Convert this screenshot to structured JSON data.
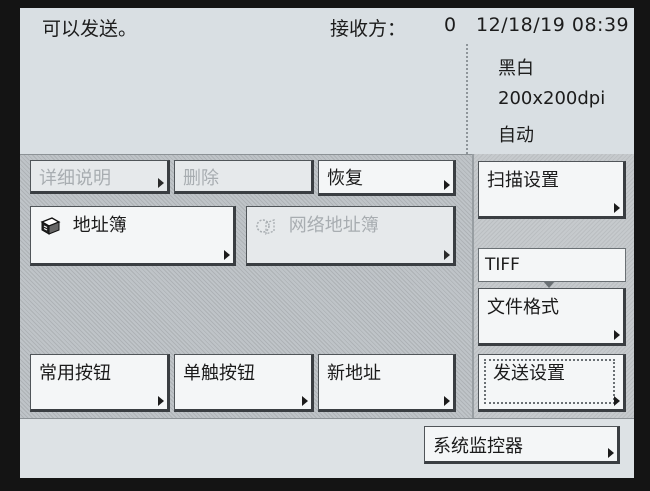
{
  "status": {
    "message": "可以发送。",
    "receiver_label": "接收方：",
    "receiver_count": "0",
    "datetime": "12/18/19 08:39"
  },
  "settings_summary": {
    "color_mode": "黑白",
    "resolution": "200x200dpi",
    "density": "自动"
  },
  "buttons": {
    "detail_info": "详细说明",
    "delete": "删除",
    "restore": "恢复",
    "address_book": "地址簿",
    "network_address_book": "网络地址簿",
    "favorites": "常用按钮",
    "one_touch": "单触按钮",
    "new_address": "新地址",
    "scan_settings": "扫描设置",
    "file_format": "文件格式",
    "send_settings": "发送设置",
    "system_monitor": "系统监控器"
  },
  "file_format_value": "TIFF",
  "icons": {
    "address_book": "address-book-icon",
    "network_address_book": "network-address-book-icon",
    "arrow": "triangle-right-icon"
  }
}
